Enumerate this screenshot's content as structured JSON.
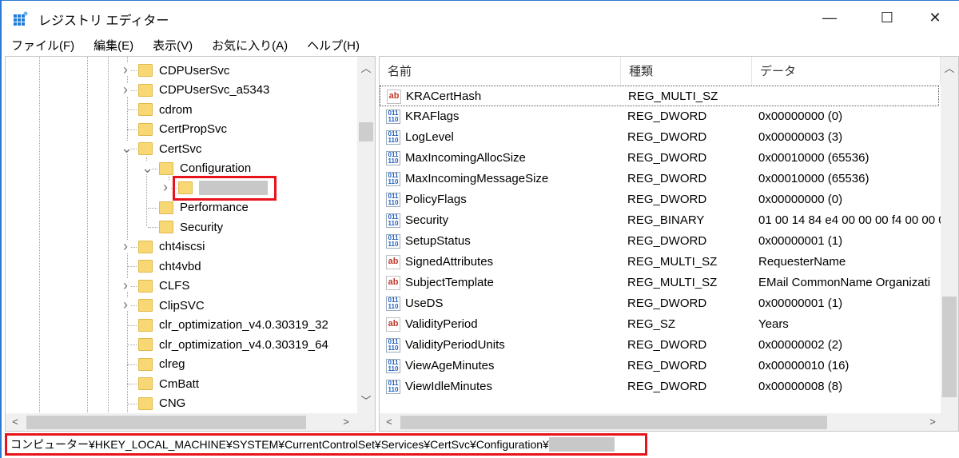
{
  "window": {
    "title": "レジストリ エディター",
    "minimize": "—",
    "maximize": "☐",
    "close": "✕"
  },
  "menu": [
    "ファイル(F)",
    "編集(E)",
    "表示(V)",
    "お気に入り(A)",
    "ヘルプ(H)"
  ],
  "tree": [
    {
      "label": "CDPUserSvc",
      "level": 3,
      "expander": "collapsed"
    },
    {
      "label": "CDPUserSvc_a5343",
      "level": 3,
      "expander": "collapsed"
    },
    {
      "label": "cdrom",
      "level": 3,
      "expander": "none"
    },
    {
      "label": "CertPropSvc",
      "level": 3,
      "expander": "none"
    },
    {
      "label": "CertSvc",
      "level": 3,
      "expander": "expanded"
    },
    {
      "label": "Configuration",
      "level": 4,
      "expander": "expanded"
    },
    {
      "label": "",
      "level": 5,
      "expander": "collapsed",
      "redacted": true,
      "highlighted": true
    },
    {
      "label": "Performance",
      "level": 4,
      "expander": "none"
    },
    {
      "label": "Security",
      "level": 4,
      "expander": "none"
    },
    {
      "label": "cht4iscsi",
      "level": 3,
      "expander": "collapsed"
    },
    {
      "label": "cht4vbd",
      "level": 3,
      "expander": "none"
    },
    {
      "label": "CLFS",
      "level": 3,
      "expander": "collapsed"
    },
    {
      "label": "ClipSVC",
      "level": 3,
      "expander": "collapsed"
    },
    {
      "label": "clr_optimization_v4.0.30319_32",
      "level": 3,
      "expander": "none"
    },
    {
      "label": "clr_optimization_v4.0.30319_64",
      "level": 3,
      "expander": "none"
    },
    {
      "label": "clreg",
      "level": 3,
      "expander": "none"
    },
    {
      "label": "CmBatt",
      "level": 3,
      "expander": "none"
    },
    {
      "label": "CNG",
      "level": 3,
      "expander": "none"
    }
  ],
  "list": {
    "columns": [
      "名前",
      "種類",
      "データ"
    ],
    "rows": [
      {
        "icon": "string-value-icon",
        "name": "KRACertHash",
        "type": "REG_MULTI_SZ",
        "data": "",
        "focused": true
      },
      {
        "icon": "binary-value-icon",
        "name": "KRAFlags",
        "type": "REG_DWORD",
        "data": "0x00000000 (0)"
      },
      {
        "icon": "binary-value-icon",
        "name": "LogLevel",
        "type": "REG_DWORD",
        "data": "0x00000003 (3)"
      },
      {
        "icon": "binary-value-icon",
        "name": "MaxIncomingAllocSize",
        "type": "REG_DWORD",
        "data": "0x00010000 (65536)"
      },
      {
        "icon": "binary-value-icon",
        "name": "MaxIncomingMessageSize",
        "type": "REG_DWORD",
        "data": "0x00010000 (65536)"
      },
      {
        "icon": "binary-value-icon",
        "name": "PolicyFlags",
        "type": "REG_DWORD",
        "data": "0x00000000 (0)"
      },
      {
        "icon": "binary-value-icon",
        "name": "Security",
        "type": "REG_BINARY",
        "data": "01 00 14 84 e4 00 00 00 f4 00 00 0"
      },
      {
        "icon": "binary-value-icon",
        "name": "SetupStatus",
        "type": "REG_DWORD",
        "data": "0x00000001 (1)"
      },
      {
        "icon": "string-value-icon",
        "name": "SignedAttributes",
        "type": "REG_MULTI_SZ",
        "data": "RequesterName"
      },
      {
        "icon": "string-value-icon",
        "name": "SubjectTemplate",
        "type": "REG_MULTI_SZ",
        "data": "EMail CommonName Organizati"
      },
      {
        "icon": "binary-value-icon",
        "name": "UseDS",
        "type": "REG_DWORD",
        "data": "0x00000001 (1)"
      },
      {
        "icon": "string-value-icon",
        "name": "ValidityPeriod",
        "type": "REG_SZ",
        "data": "Years"
      },
      {
        "icon": "binary-value-icon",
        "name": "ValidityPeriodUnits",
        "type": "REG_DWORD",
        "data": "0x00000002 (2)"
      },
      {
        "icon": "binary-value-icon",
        "name": "ViewAgeMinutes",
        "type": "REG_DWORD",
        "data": "0x00000010 (16)"
      },
      {
        "icon": "binary-value-icon",
        "name": "ViewIdleMinutes",
        "type": "REG_DWORD",
        "data": "0x00000008 (8)"
      }
    ]
  },
  "status": {
    "path": "コンピューター¥HKEY_LOCAL_MACHINE¥SYSTEM¥CurrentControlSet¥Services¥CertSvc¥Configuration¥",
    "redacted_tail": true
  },
  "colors": {
    "highlight": "#e8131b",
    "folder": "#f8d775",
    "accent": "#2b79d0"
  }
}
